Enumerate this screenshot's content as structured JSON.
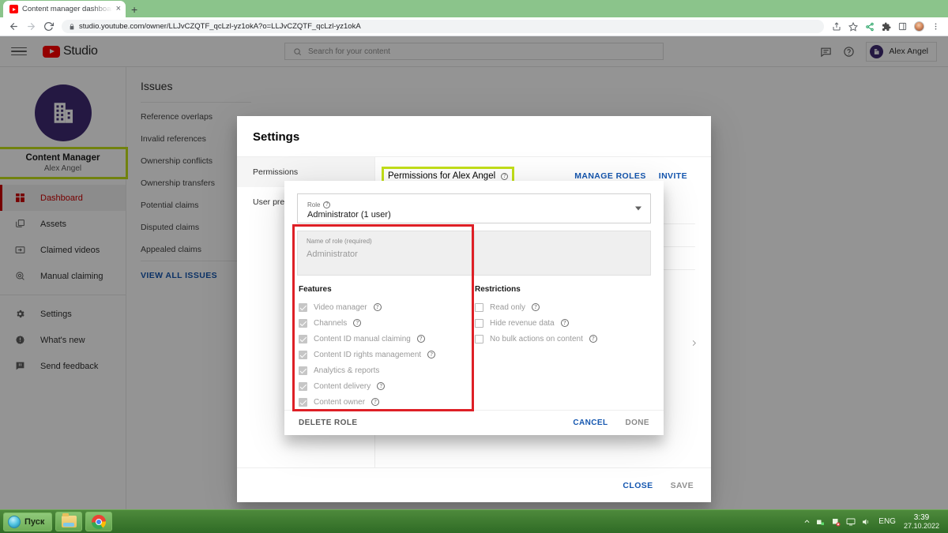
{
  "browser": {
    "tab": {
      "title": "Content manager dashboard - Yo",
      "close_label": "×",
      "favicon": "youtube-favicon"
    },
    "new_tab_label": "+",
    "nav": {
      "back": "←",
      "forward": "→",
      "reload": "↻"
    },
    "omnibox": {
      "url": "studio.youtube.com/owner/LLJvCZQTF_qcLzl-yz1okA?o=LLJvCZQTF_qcLzl-yz1okA",
      "lock_icon": "lock-icon"
    },
    "toolbar_icons": [
      "share-icon",
      "star-icon",
      "extensions-puzzle-icon",
      "sidepanel-icon",
      "profile-avatar",
      "kebab-menu-icon"
    ]
  },
  "studio_header": {
    "menu_icon": "hamburger-icon",
    "logo_text": "Studio",
    "search_placeholder": "Search for your content",
    "search_icon": "search-icon",
    "feedback_icon": "comment-icon",
    "help_icon": "help-icon",
    "account_name": "Alex Angel"
  },
  "sidebar": {
    "channel_name": "Content Manager",
    "channel_owner": "Alex Angel",
    "avatar_icon": "building-icon",
    "items": [
      {
        "label": "Dashboard",
        "icon": "dashboard-icon",
        "active": true
      },
      {
        "label": "Assets",
        "icon": "assets-icon",
        "active": false
      },
      {
        "label": "Claimed videos",
        "icon": "claimed-videos-icon",
        "active": false
      },
      {
        "label": "Manual claiming",
        "icon": "manual-claiming-icon",
        "active": false
      }
    ],
    "items2": [
      {
        "label": "Settings",
        "icon": "gear-icon"
      },
      {
        "label": "What's new",
        "icon": "whats-new-icon"
      },
      {
        "label": "Send feedback",
        "icon": "send-feedback-icon"
      }
    ]
  },
  "issues_card": {
    "heading": "Issues",
    "rows": [
      "Reference overlaps",
      "Invalid references",
      "Ownership conflicts",
      "Ownership transfers",
      "Potential claims",
      "Disputed claims",
      "Appealed claims"
    ],
    "view_all": "VIEW ALL ISSUES"
  },
  "settings_dialog": {
    "title": "Settings",
    "nav": [
      {
        "label": "Permissions",
        "selected": true
      },
      {
        "label": "User prefere",
        "selected": false
      }
    ],
    "permissions_title": "Permissions for Alex Angel",
    "permissions_help_icon": "help-icon",
    "manage_roles": "MANAGE ROLES",
    "invite": "INVITE",
    "chevron_icon": "chevron-right-icon",
    "close": "CLOSE",
    "save": "SAVE"
  },
  "role_popup": {
    "role_label": "Role",
    "role_help_icon": "help-icon",
    "role_value": "Administrator (1 user)",
    "caret_icon": "chevron-down-icon",
    "name_label": "Name of role (required)",
    "name_value": "Administrator",
    "features_heading": "Features",
    "features": [
      {
        "label": "Video manager",
        "checked": true,
        "help": true
      },
      {
        "label": "Channels",
        "checked": true,
        "help": true
      },
      {
        "label": "Content ID manual claiming",
        "checked": true,
        "help": true
      },
      {
        "label": "Content ID rights management",
        "checked": true,
        "help": true
      },
      {
        "label": "Analytics & reports",
        "checked": true,
        "help": false
      },
      {
        "label": "Content delivery",
        "checked": true,
        "help": true
      },
      {
        "label": "Content owner",
        "checked": true,
        "help": true
      }
    ],
    "restrictions_heading": "Restrictions",
    "restrictions": [
      {
        "label": "Read only",
        "checked": false,
        "help": true
      },
      {
        "label": "Hide revenue data",
        "checked": false,
        "help": true
      },
      {
        "label": "No bulk actions on content",
        "checked": false,
        "help": true
      }
    ],
    "delete_role": "DELETE ROLE",
    "cancel": "CANCEL",
    "done": "DONE"
  },
  "highlights": {
    "green_color": "#c3e019",
    "red_color": "#de1f26"
  },
  "taskbar": {
    "start_label": "Пуск",
    "tasks": [
      "explorer-icon",
      "chrome-icon"
    ],
    "tray_icons": [
      "show-hidden-icon",
      "network-icon",
      "security-icon",
      "display-icon",
      "volume-icon"
    ],
    "language": "ENG",
    "time": "3:39",
    "date": "27.10.2022"
  }
}
